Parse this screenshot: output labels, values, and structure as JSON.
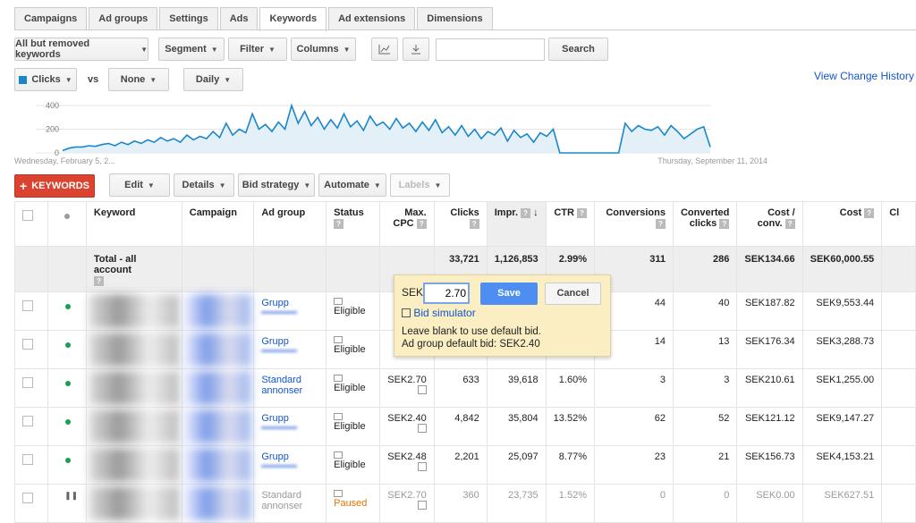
{
  "tabs": [
    {
      "label": "Campaigns"
    },
    {
      "label": "Ad groups"
    },
    {
      "label": "Settings"
    },
    {
      "label": "Ads"
    },
    {
      "label": "Keywords",
      "active": true
    },
    {
      "label": "Ad extensions"
    },
    {
      "label": "Dimensions"
    }
  ],
  "toolbar": {
    "filter_view": "All but removed keywords",
    "segment": "Segment",
    "filter": "Filter",
    "columns": "Columns",
    "search_value": "",
    "search_button": "Search",
    "chart_icon": "line-chart-icon",
    "download_icon": "download-icon"
  },
  "chart_controls": {
    "metric1": "Clicks",
    "metric1_color": "#1a87c9",
    "vs": "vs",
    "metric2": "None",
    "period": "Daily",
    "view_change_history": "View Change History"
  },
  "chart_data": {
    "type": "area",
    "ylim": [
      0,
      400
    ],
    "yticks": [
      "400",
      "200",
      "0"
    ],
    "start_label": "Wednesday, February 5, 2...",
    "end_label": "Thursday, September 11, 2014",
    "series": [
      {
        "color": "#1a87c9",
        "values": [
          20,
          40,
          50,
          50,
          60,
          55,
          70,
          80,
          60,
          90,
          70,
          100,
          80,
          110,
          90,
          130,
          100,
          120,
          90,
          150,
          110,
          140,
          120,
          180,
          130,
          250,
          150,
          200,
          170,
          330,
          200,
          240,
          180,
          260,
          200,
          400,
          250,
          350,
          230,
          300,
          200,
          280,
          210,
          330,
          220,
          270,
          190,
          310,
          230,
          260,
          200,
          290,
          210,
          250,
          180,
          260,
          190,
          280,
          170,
          220,
          150,
          230,
          140,
          200,
          120,
          180,
          150,
          210,
          100,
          190,
          130,
          160,
          90,
          170,
          140,
          200,
          0,
          0,
          0,
          0,
          0,
          0,
          0,
          0,
          0,
          0,
          250,
          180,
          230,
          200,
          190,
          220,
          150,
          230,
          180,
          120,
          160,
          200,
          220,
          50
        ]
      }
    ]
  },
  "actions": {
    "add_keywords": "KEYWORDS",
    "edit": "Edit",
    "details": "Details",
    "bid_strategy": "Bid strategy",
    "automate": "Automate",
    "labels": "Labels"
  },
  "table": {
    "headers": [
      "",
      "",
      "Keyword",
      "Campaign",
      "Ad group",
      "Status",
      "Max. CPC",
      "Clicks",
      "Impr.",
      "CTR",
      "Conversions",
      "Converted clicks",
      "Cost / conv.",
      "Cost",
      "Cl"
    ],
    "total": {
      "label": "Total - all account",
      "clicks": "33,721",
      "impr": "1,126,853",
      "ctr": "2.99%",
      "conv": "311",
      "conv_clicks": "286",
      "cost_conv": "SEK134.66",
      "cost": "SEK60,000.55"
    },
    "rows": [
      {
        "adgroup": "Grupp",
        "status": "Eligible",
        "maxcpc": "",
        "clicks": "",
        "impr": "",
        "ctr": "",
        "conv": "44",
        "conv_clicks": "40",
        "cost_conv": "SEK187.82",
        "cost": "SEK9,553.44"
      },
      {
        "adgroup": "Grupp",
        "status": "Eligible",
        "maxcpc": "",
        "clicks": "",
        "impr": "",
        "ctr": "",
        "conv": "14",
        "conv_clicks": "13",
        "cost_conv": "SEK176.34",
        "cost": "SEK3,288.73"
      },
      {
        "adgroup": "Standard annonser",
        "status": "Eligible",
        "maxcpc": "SEK2.70",
        "clicks": "633",
        "impr": "39,618",
        "ctr": "1.60%",
        "conv": "3",
        "conv_clicks": "3",
        "cost_conv": "SEK210.61",
        "cost": "SEK1,255.00"
      },
      {
        "adgroup": "Grupp",
        "status": "Eligible",
        "maxcpc": "SEK2.40",
        "clicks": "4,842",
        "impr": "35,804",
        "ctr": "13.52%",
        "conv": "62",
        "conv_clicks": "52",
        "cost_conv": "SEK121.12",
        "cost": "SEK9,147.27"
      },
      {
        "adgroup": "Grupp",
        "status": "Eligible",
        "maxcpc": "SEK2.48",
        "clicks": "2,201",
        "impr": "25,097",
        "ctr": "8.77%",
        "conv": "23",
        "conv_clicks": "21",
        "cost_conv": "SEK156.73",
        "cost": "SEK4,153.21"
      },
      {
        "adgroup": "Standard annonser",
        "status": "Paused",
        "maxcpc": "SEK2.70",
        "clicks": "360",
        "impr": "23,735",
        "ctr": "1.52%",
        "conv": "0",
        "conv_clicks": "0",
        "cost_conv": "SEK0.00",
        "cost": "SEK627.51",
        "paused": true
      }
    ]
  },
  "popup": {
    "currency": "SEK",
    "bid_value": "2.70",
    "save": "Save",
    "cancel": "Cancel",
    "bid_simulator": "Bid simulator",
    "hint1": "Leave blank to use default bid.",
    "hint2": "Ad group default bid: SEK2.40"
  }
}
